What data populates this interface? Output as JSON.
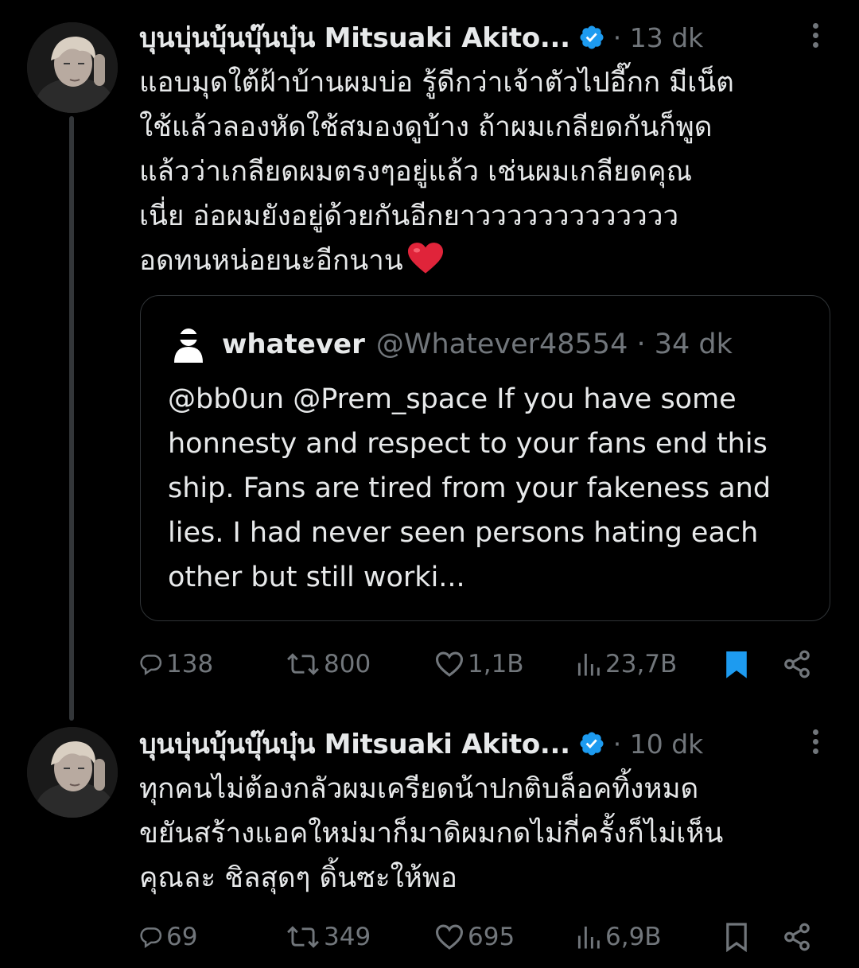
{
  "colors": {
    "background": "#000000",
    "text": "#e7e9ea",
    "secondary": "#71767b",
    "verified": "#1d9bf0",
    "bookmark_active": "#1d9bf0",
    "heart_emoji": "#e0243a"
  },
  "tweets": [
    {
      "author": "บุนบุ่นบุ้นบุ๊นบุ๋น Mitsuaki Akito...",
      "timestamp": "· 13 dk",
      "text": "แอบมุดใต้ฝ้าบ้านผมบ่อ รู้ดีกว่าเจ้าตัวไปอี๊กก มีเน็ต\nใช้แล้วลองหัดใช้สมองดูบ้าง ถ้าผมเกลียดกันก็พูด\nแล้วว่าเกลียดผมตรงๆอยู่แล้ว เช่นผมเกลียดคุณ\nเนี่ย อ่อผมยังอยู่ด้วยกันอีกยาววววววววววววว\nอดทนหน่อยนะอีกนาน",
      "emoji": "red-heart",
      "quote": {
        "name": "whatever",
        "handle": "@Whatever48554 · 34 dk",
        "text": "@bb0un @Prem_space If you have some honnesty and respect to your fans end this ship. Fans are tired from your fakeness and lies. I had never seen persons hating each other but still worki..."
      },
      "actions": {
        "replies": "138",
        "reposts": "800",
        "likes": "1,1B",
        "views": "23,7B",
        "bookmarked": true
      }
    },
    {
      "author": "บุนบุ่นบุ้นบุ๊นบุ๋น Mitsuaki Akito...",
      "timestamp": "· 10 dk",
      "text": "ทุกคนไม่ต้องกลัวผมเครียดน้าปกติบล็อคทิ้งหมด\nขยันสร้างแอคใหม่มาก็มาดิผมกดไม่กี่ครั้งก็ไม่เห็น\nคุณละ ชิลสุดๆ ดิ้นซะให้พอ",
      "actions": {
        "replies": "69",
        "reposts": "349",
        "likes": "695",
        "views": "6,9B",
        "bookmarked": false
      }
    }
  ]
}
